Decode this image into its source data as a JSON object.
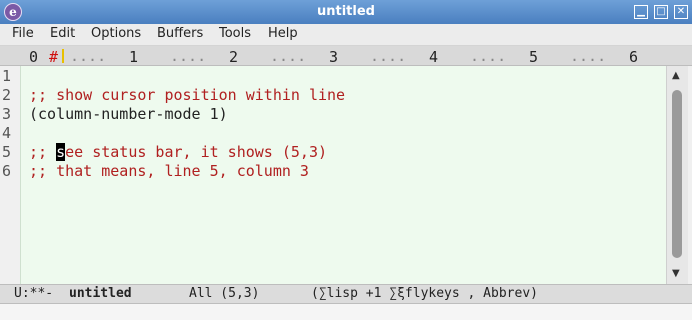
{
  "titlebar": {
    "title": "untitled",
    "minimize": "▁",
    "maximize": "□",
    "close": "✕",
    "app_icon": "emacs-icon"
  },
  "menubar": {
    "items": [
      "File",
      "Edit",
      "Options",
      "Buffers",
      "Tools",
      "Help"
    ]
  },
  "ruler": {
    "zero": "0",
    "hash": "#",
    "ticks": [
      "1",
      "2",
      "3",
      "4",
      "5",
      "6"
    ],
    "dots": "...."
  },
  "gutter": {
    "line_numbers": [
      "1",
      "2",
      "3",
      "4",
      "5",
      "6"
    ]
  },
  "editor": {
    "lines": [
      "",
      ";; show cursor position within line",
      "(column-number-mode 1)",
      "",
      ";; see status bar, it shows (5,3)",
      ";; that means, line 5, column 3"
    ],
    "line5_prefix": ";; ",
    "line5_cursor_char": "s",
    "line5_rest": "ee status bar, it shows (5,3)"
  },
  "modeline": {
    "status": "U:**-",
    "buffer_name": "untitled",
    "position": "All (5,3)",
    "modes": "(∑lisp +1 ∑ξflykeys , Abbrev)"
  },
  "colors": {
    "editor_bg": "#eefaee",
    "comment": "#b02020",
    "titlebar": "#4a7fc0"
  }
}
